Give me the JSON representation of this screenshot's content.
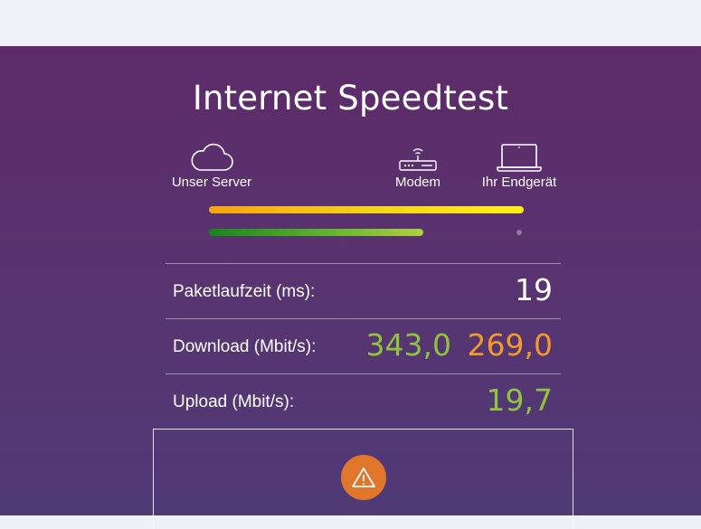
{
  "header": {
    "title": "Internet Speedtest"
  },
  "nodes": {
    "server": {
      "label": "Unser Server",
      "icon": "cloud-icon"
    },
    "modem": {
      "label": "Modem",
      "icon": "modem-icon"
    },
    "device": {
      "label": "Ihr Endgerät",
      "icon": "laptop-icon"
    }
  },
  "bars": {
    "max_speed_fraction": 1.0,
    "current_speed_fraction": 0.68,
    "max_color_gradient": [
      "#f6a412",
      "#f5d719",
      "#ffef1a"
    ],
    "current_color_gradient": [
      "#16861c",
      "#5fb52a",
      "#aed140"
    ]
  },
  "results": {
    "ping": {
      "label": "Paketlaufzeit (ms):",
      "value": "19"
    },
    "download": {
      "label": "Download (Mbit/s):",
      "value_current": "343,0",
      "value_max": "269,0"
    },
    "upload": {
      "label": "Upload (Mbit/s):",
      "value": "19,7"
    }
  },
  "info": {
    "icon": "warning-icon",
    "icon_color": "#e0762c"
  },
  "colors": {
    "panel_background": "#5e2b69",
    "green_value": "#8fc43f",
    "orange_value": "#f39a2e"
  }
}
